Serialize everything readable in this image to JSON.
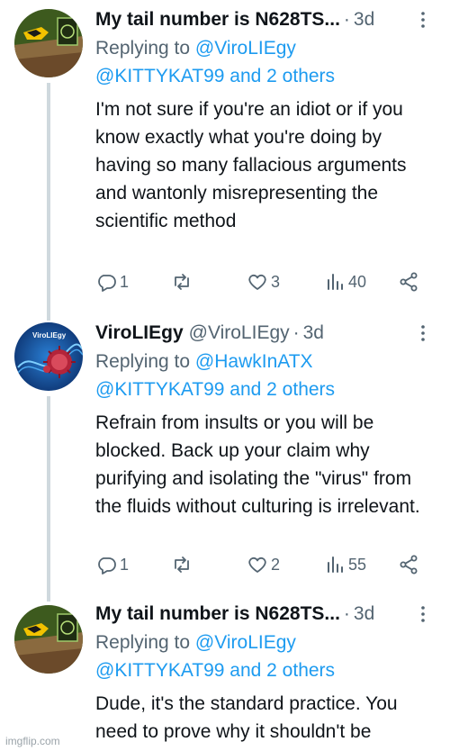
{
  "tweets": [
    {
      "name": "My tail number is N628TS...",
      "handle": "",
      "time": "3d",
      "reply_prefix": "Replying to",
      "reply_to_1": "@ViroLIEgy",
      "reply_to_2": "@KITTYKAT99 and 2 others",
      "body": "I'm not sure if you're an idiot or if you know exactly what you're doing by having so many fallacious arguments and wantonly misrepresenting the scientific method",
      "replies": "1",
      "retweets": "",
      "likes": "3",
      "views": "40",
      "avatar": "hawk-avatar-icon"
    },
    {
      "name": "ViroLIEgy",
      "handle": "@ViroLIEgy",
      "time": "3d",
      "reply_prefix": "Replying to",
      "reply_to_1": "@HawkInATX",
      "reply_to_2": "@KITTYKAT99 and 2 others",
      "body": "Refrain from insults or you will be blocked. Back up your claim why purifying and isolating the \"virus\" from the fluids without culturing is irrelevant.",
      "replies": "1",
      "retweets": "",
      "likes": "2",
      "views": "55",
      "avatar": "virus-avatar-icon",
      "avatar_text": "ViroLIEgy"
    },
    {
      "name": "My tail number is N628TS...",
      "handle": "",
      "time": "3d",
      "reply_prefix": "Replying to",
      "reply_to_1": "@ViroLIEgy",
      "reply_to_2": "@KITTYKAT99 and 2 others",
      "body": "Dude, it's the standard practice. You need to prove why it shouldn't be",
      "avatar": "hawk-avatar-icon"
    }
  ],
  "watermark": "imgflip.com",
  "colors": {
    "text": "#0f1419",
    "muted": "#536471",
    "link": "#1d9bf0",
    "thread": "#cfd9de"
  }
}
